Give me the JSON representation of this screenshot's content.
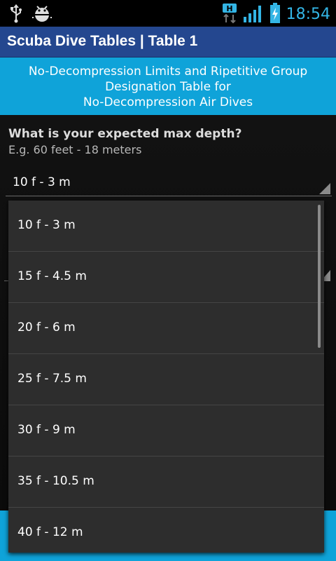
{
  "status_bar": {
    "time": "18:54",
    "icons": [
      "usb-icon",
      "android-debug-icon",
      "hspa-data-icon",
      "signal-icon",
      "battery-charging-icon"
    ],
    "accent_color": "#33b5e5"
  },
  "titlebar": {
    "title": "Scuba Dive Tables | Table 1"
  },
  "header": {
    "line1": "No-Decompression Limits and Ripetitive Group",
    "line2": "Designation Table for",
    "line3": "No-Decompression Air Dives"
  },
  "form": {
    "question": "What is your expected max depth?",
    "hint": "E.g. 60 feet - 18 meters",
    "depth_selected": "10 f - 3 m"
  },
  "dropdown": {
    "options": [
      "10 f - 3 m",
      "15 f - 4.5 m",
      "20 f - 6 m",
      "25 f - 7.5 m",
      "30 f - 9 m",
      "35 f - 10.5 m",
      "40 f - 12 m"
    ]
  },
  "colors": {
    "title_bar": "#24478f",
    "header": "#0fa3d9"
  }
}
